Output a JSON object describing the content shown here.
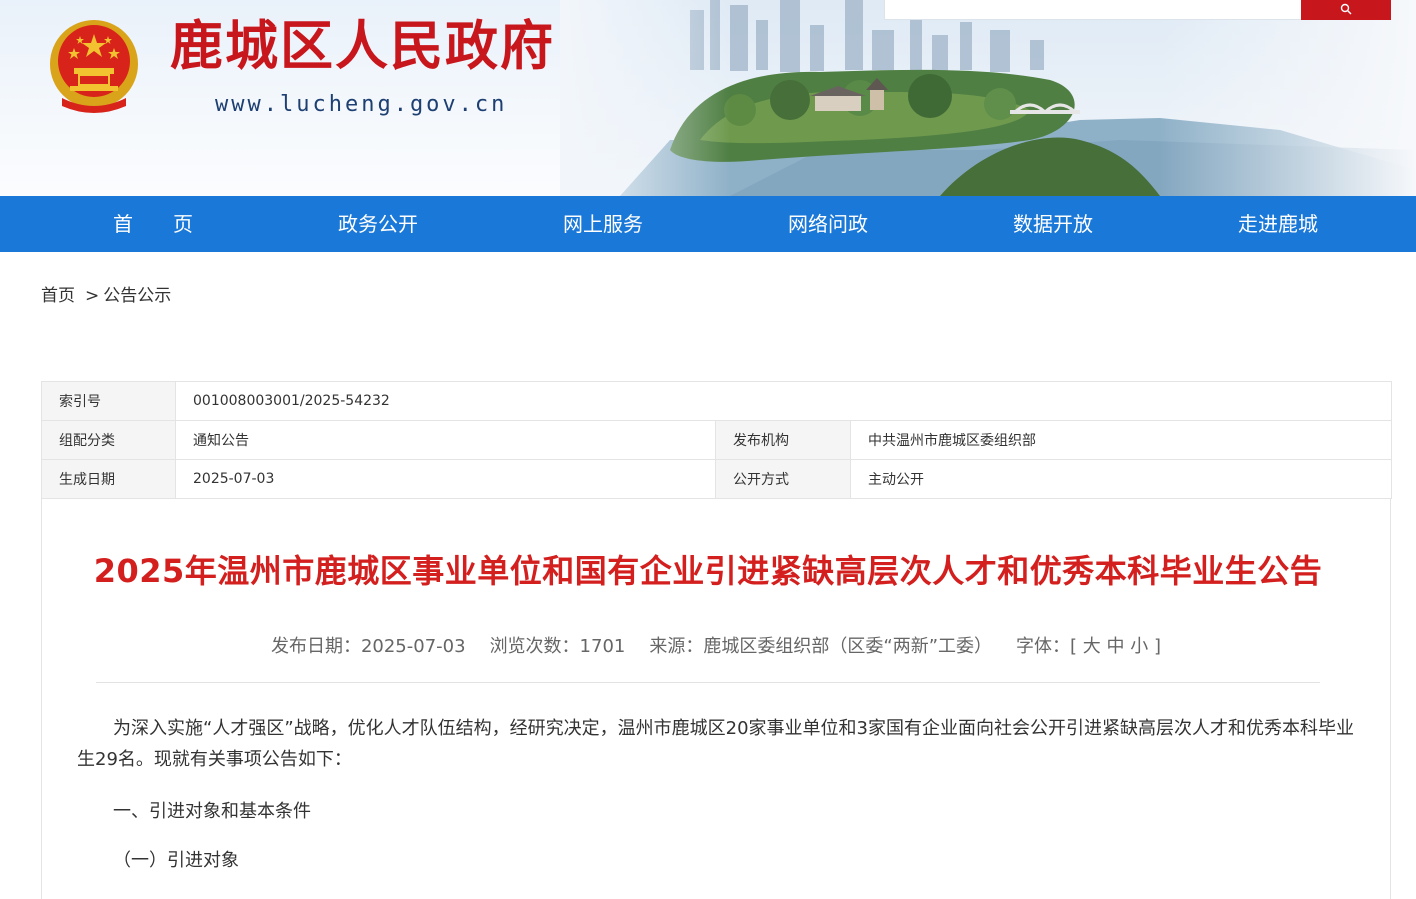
{
  "site": {
    "name": "鹿城区人民政府",
    "url": "www.lucheng.gov.cn"
  },
  "colors": {
    "brand_red": "#c8161d",
    "nav_blue": "#1a78d8",
    "title_red": "#d3201f"
  },
  "search": {
    "placeholder": ""
  },
  "nav": {
    "items": [
      "首　　页",
      "政务公开",
      "网上服务",
      "网络问政",
      "数据开放",
      "走进鹿城"
    ]
  },
  "breadcrumb": {
    "home": "首页",
    "separator": ">",
    "current": "公告公示"
  },
  "info": {
    "index_label": "索引号",
    "index_value": "001008003001/2025-54232",
    "category_label": "组配分类",
    "category_value": "通知公告",
    "publisher_label": "发布机构",
    "publisher_value": "中共温州市鹿城区委组织部",
    "date_label": "生成日期",
    "date_value": "2025-07-03",
    "mode_label": "公开方式",
    "mode_value": "主动公开"
  },
  "article": {
    "title": "2025年温州市鹿城区事业单位和国有企业引进紧缺高层次人才和优秀本科毕业生公告",
    "meta": {
      "publish_date": "发布日期：2025-07-03",
      "views": "浏览次数：1701",
      "source": "来源：鹿城区委组织部（区委“两新”工委）",
      "font_label": "字体：[",
      "font_large": "大",
      "font_medium": "中",
      "font_small": "小",
      "font_close": "]"
    },
    "paragraphs": {
      "intro": "为深入实施“人才强区”战略，优化人才队伍结构，经研究决定，温州市鹿城区20家事业单位和3家国有企业面向社会公开引进紧缺高层次人才和优秀本科毕业生29名。现就有关事项公告如下：",
      "section1": "一、引进对象和基本条件",
      "section1_1": "（一）引进对象"
    }
  },
  "icons": [
    "national-emblem-icon",
    "search-icon"
  ]
}
